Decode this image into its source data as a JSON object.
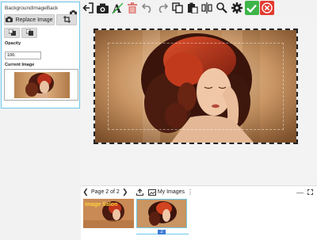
{
  "panel": {
    "title": "BackgroundImageBack",
    "replace_label": "Replace Image",
    "opacity_label": "Opacity",
    "opacity_value": "100.",
    "current_image_label": "Current Image"
  },
  "toolbar": {
    "icons": [
      "exit-icon",
      "camera-icon",
      "text-icon",
      "delete-icon",
      "undo-icon",
      "redo-icon",
      "copy-icon",
      "paste-icon",
      "align-icon",
      "zoom-icon",
      "settings-icon",
      "confirm-icon",
      "cancel-icon"
    ]
  },
  "pager": {
    "page_label": "Page 2 of 2",
    "my_images_label": "My Images",
    "minimize_label": "—"
  },
  "pages": {
    "thumb1_caption": "Image Salon",
    "page2_number": "2"
  },
  "colors": {
    "accent": "#6cc7ea",
    "confirm": "#3db548",
    "cancel": "#e23b2e",
    "delete": "#d9534f"
  }
}
